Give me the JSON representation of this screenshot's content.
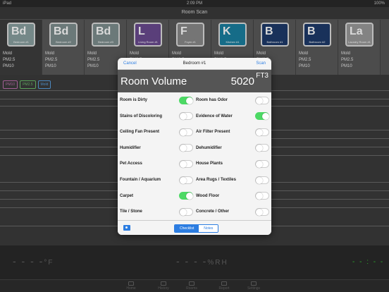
{
  "status": {
    "device": "iPad",
    "time": "2:09 PM",
    "battery": "100%"
  },
  "nav": {
    "title": "Room Scan"
  },
  "rooms": [
    {
      "abbr": "Bd",
      "name": "Bedroom #1",
      "color": "#8aa0a0",
      "mold": "Mold",
      "pm25": "PM2.5",
      "pm10": "PM10",
      "active": true
    },
    {
      "abbr": "Bd",
      "name": "Bedroom #2",
      "color": "#7e8f8f",
      "mold": "Mold",
      "pm25": "PM2.5",
      "pm10": "PM10",
      "active": false
    },
    {
      "abbr": "Bd",
      "name": "Bedroom #3",
      "color": "#7e8f8f",
      "mold": "Mold",
      "pm25": "PM2.5",
      "pm10": "PM10",
      "active": false
    },
    {
      "abbr": "L",
      "name": "Living Room #1",
      "color": "#6a4a90",
      "mold": "Mold",
      "pm25": "PM2.5",
      "pm10": "PM10",
      "active": false
    },
    {
      "abbr": "F",
      "name": "Foyer #1",
      "color": "#8a8a8a",
      "mold": "Mold",
      "pm25": "PM2.5",
      "pm10": "PM10",
      "active": false
    },
    {
      "abbr": "K",
      "name": "Kitchen #1",
      "color": "#1a7fa0",
      "mold": "Mold",
      "pm25": "PM2.5",
      "pm10": "PM10",
      "active": false
    },
    {
      "abbr": "B",
      "name": "Bathroom #1",
      "color": "#1e3a6a",
      "mold": "Mold",
      "pm25": "PM2.5",
      "pm10": "PM10",
      "active": false
    },
    {
      "abbr": "B",
      "name": "Bathroom #2",
      "color": "#1e3a6a",
      "mold": "Mold",
      "pm25": "PM2.5",
      "pm10": "PM10",
      "active": false
    },
    {
      "abbr": "La",
      "name": "Laundry Room #1",
      "color": "#9a9a9a",
      "mold": "Mold",
      "pm25": "PM2.5",
      "pm10": "PM10",
      "active": false
    }
  ],
  "badges": [
    {
      "label": "PM10",
      "color": "#c070b0"
    },
    {
      "label": "PM2.5",
      "color": "#6cc06c"
    },
    {
      "label": "Mold",
      "color": "#5aa0e0"
    }
  ],
  "modal": {
    "cancel": "Cancel",
    "title": "Bedroom #1",
    "scan": "Scan",
    "volume_label": "Room Volume",
    "volume_value": "5020",
    "volume_unit": "FT3",
    "checklist": [
      {
        "label": "Room is Dirty",
        "on": true
      },
      {
        "label": "Room has Odor",
        "on": false
      },
      {
        "label": "Stains of Discoloring",
        "on": false
      },
      {
        "label": "Evidence of Water",
        "on": true
      },
      {
        "label": "Ceiling Fan Present",
        "on": false
      },
      {
        "label": "Air Filter Present",
        "on": false
      },
      {
        "label": "Humidifier",
        "on": false
      },
      {
        "label": "Dehumidifier",
        "on": false
      },
      {
        "label": "Pet Access",
        "on": false
      },
      {
        "label": "House Plants",
        "on": false
      },
      {
        "label": "Fountain / Aquarium",
        "on": false
      },
      {
        "label": "Area Rugs / Textiles",
        "on": false
      },
      {
        "label": "Carpet",
        "on": true
      },
      {
        "label": "Wood Floor",
        "on": false
      },
      {
        "label": "Tile / Stone",
        "on": false
      },
      {
        "label": "Concrete / Other",
        "on": false
      }
    ],
    "seg_checklist": "Checklist",
    "seg_notes": "Notes"
  },
  "readings": {
    "temp": "- - - -",
    "temp_unit": "°F",
    "rh": "- - - -",
    "rh_unit": "%RH",
    "right": "- - : - -",
    "right_color": "#33cc33"
  },
  "tabs": [
    "Home",
    "History",
    "Rooms",
    "Report",
    "Settings"
  ]
}
